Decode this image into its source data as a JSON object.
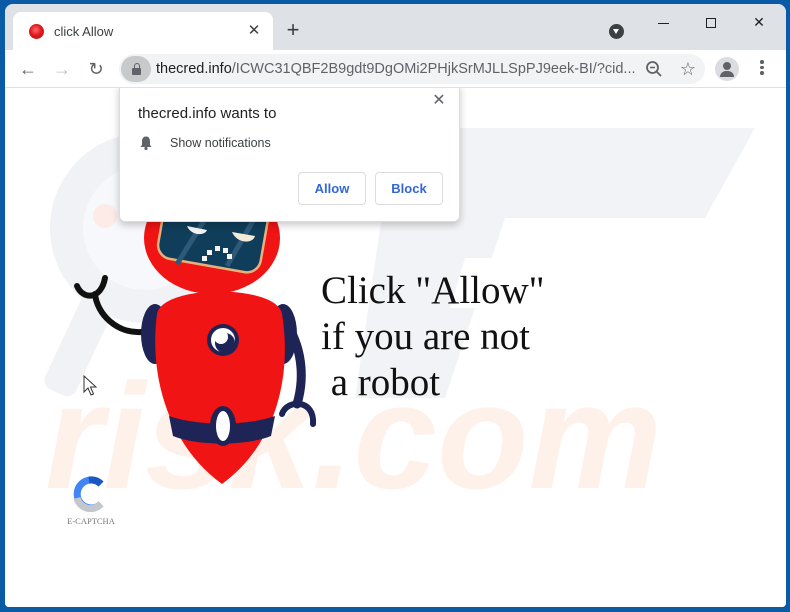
{
  "browser": {
    "tab": {
      "title": "click Allow",
      "favicon": "red-circle-icon",
      "close_label": "✕"
    },
    "new_tab_label": "+",
    "window_controls": {
      "minimize": "minimize-icon",
      "maximize": "maximize-icon",
      "close": "✕"
    },
    "toolbar": {
      "back": "←",
      "forward": "→",
      "reload": "↻",
      "url_host": "thecred.info",
      "url_path": "/ICWC31QBF2B9gdt9DgOMi2PHjkSrMJLLSpPJ9eek-BI/?cid...",
      "star": "☆"
    }
  },
  "popup": {
    "title": "thecred.info wants to",
    "permission": "Show notifications",
    "close_label": "✕",
    "allow_label": "Allow",
    "block_label": "Block"
  },
  "page": {
    "headline": "Click \"Allow\"\nif you are not\n a robot",
    "captcha_label": "E-CAPTCHA",
    "watermark_text": "risk.com"
  },
  "colors": {
    "desktop": "#0b5aa5",
    "robot_red": "#f01414",
    "robot_navy": "#1e2456",
    "button_text": "#3367d6"
  }
}
